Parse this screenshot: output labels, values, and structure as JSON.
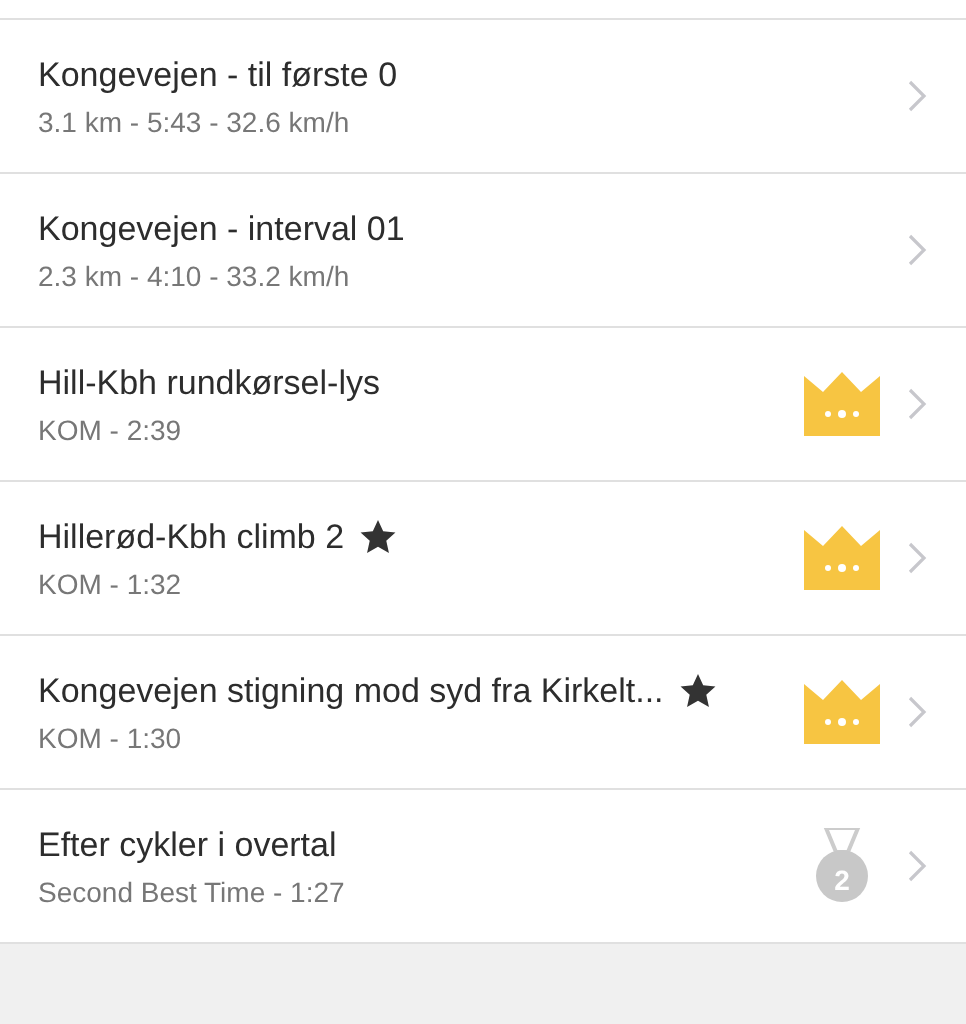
{
  "segments": [
    {
      "name": "Kongevejen - til første 0",
      "detail": "3.1 km - 5:43 - 32.6 km/h",
      "starred": false,
      "award": {
        "kind": "none"
      }
    },
    {
      "name": "Kongevejen - interval 01",
      "detail": "2.3 km - 4:10 - 33.2 km/h",
      "starred": false,
      "award": {
        "kind": "none"
      }
    },
    {
      "name": "Hill-Kbh rundkørsel-lys",
      "detail": "KOM - 2:39",
      "starred": false,
      "award": {
        "kind": "crown"
      }
    },
    {
      "name": "Hillerød-Kbh climb 2",
      "detail": "KOM - 1:32",
      "starred": true,
      "award": {
        "kind": "crown"
      }
    },
    {
      "name": "Kongevejen stigning mod syd fra Kirkelt...",
      "detail": "KOM - 1:30",
      "starred": true,
      "award": {
        "kind": "crown"
      }
    },
    {
      "name": "Efter cykler i overtal",
      "detail": "Second Best Time - 1:27",
      "starred": false,
      "award": {
        "kind": "medal",
        "label": "2"
      }
    }
  ]
}
